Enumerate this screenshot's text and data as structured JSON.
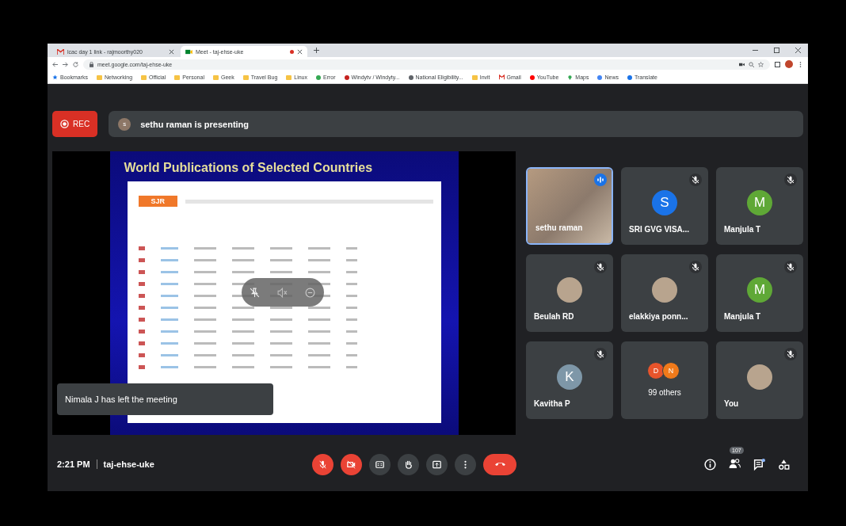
{
  "browser": {
    "tabs": [
      {
        "title": "lcac day 1 link - rajmoorthy020",
        "selected": false,
        "kind": "mail"
      },
      {
        "title": "Meet - taj-ehse-uke",
        "selected": true,
        "kind": "meet"
      }
    ],
    "url": "meet.google.com/taj-ehse-uke",
    "bookmarks": [
      {
        "label": "Bookmarks",
        "kind": "star"
      },
      {
        "label": "Networking",
        "kind": "folder"
      },
      {
        "label": "Official",
        "kind": "folder"
      },
      {
        "label": "Personal",
        "kind": "folder"
      },
      {
        "label": "Geek",
        "kind": "folder"
      },
      {
        "label": "Travel Bug",
        "kind": "folder"
      },
      {
        "label": "Linux",
        "kind": "folder"
      },
      {
        "label": "Error",
        "kind": "site",
        "color": "#34a853"
      },
      {
        "label": "Windytv / Windyty...",
        "kind": "site",
        "color": "#c5221f"
      },
      {
        "label": "National Eligibility...",
        "kind": "site",
        "color": "#5f6368"
      },
      {
        "label": "Invit",
        "kind": "folder"
      },
      {
        "label": "Gmail",
        "kind": "mail"
      },
      {
        "label": "YouTube",
        "kind": "site",
        "color": "#ff0000"
      },
      {
        "label": "Maps",
        "kind": "pin"
      },
      {
        "label": "News",
        "kind": "site",
        "color": "#4285f4"
      },
      {
        "label": "Translate",
        "kind": "site",
        "color": "#1a73e8"
      }
    ]
  },
  "meet": {
    "recording": {
      "label": "REC"
    },
    "presenter": {
      "initial": "s",
      "text": "sethu raman is presenting"
    },
    "slide": {
      "title": "World Publications of Selected Countries",
      "logo": "SJR"
    },
    "toast": "Nimala J has left the meeting",
    "tiles": [
      {
        "name": "sethu raman",
        "kind": "video",
        "speaking": true,
        "muted": false
      },
      {
        "name": "SRI GVG VISA...",
        "kind": "letter",
        "letter": "S",
        "color": "#1a73e8",
        "speaking": false,
        "muted": true
      },
      {
        "name": "Manjula T",
        "kind": "letter",
        "letter": "M",
        "color": "#5fa836",
        "speaking": false,
        "muted": true
      },
      {
        "name": "Beulah RD",
        "kind": "photo",
        "speaking": false,
        "muted": true
      },
      {
        "name": "elakkiya ponn...",
        "kind": "photo",
        "speaking": false,
        "muted": true
      },
      {
        "name": "Manjula T",
        "kind": "letter",
        "letter": "M",
        "color": "#5fa836",
        "speaking": false,
        "muted": true
      },
      {
        "name": "Kavitha P",
        "kind": "letter",
        "letter": "K",
        "color": "#7e97a8",
        "speaking": false,
        "muted": true
      },
      {
        "name": "99 others",
        "kind": "group",
        "avatars": [
          {
            "letter": "D",
            "color": "#e8542b"
          },
          {
            "letter": "N",
            "color": "#f07a1a"
          }
        ],
        "speaking": false,
        "muted": false
      },
      {
        "name": "You",
        "kind": "photo",
        "speaking": false,
        "muted": true
      }
    ],
    "time": "2:21 PM",
    "code": "taj-ehse-uke",
    "controls": [
      {
        "kind": "mic",
        "on": false
      },
      {
        "kind": "camera",
        "on": false
      },
      {
        "kind": "captions"
      },
      {
        "kind": "hand"
      },
      {
        "kind": "present"
      },
      {
        "kind": "more"
      },
      {
        "kind": "end"
      }
    ],
    "people_count": "107"
  }
}
